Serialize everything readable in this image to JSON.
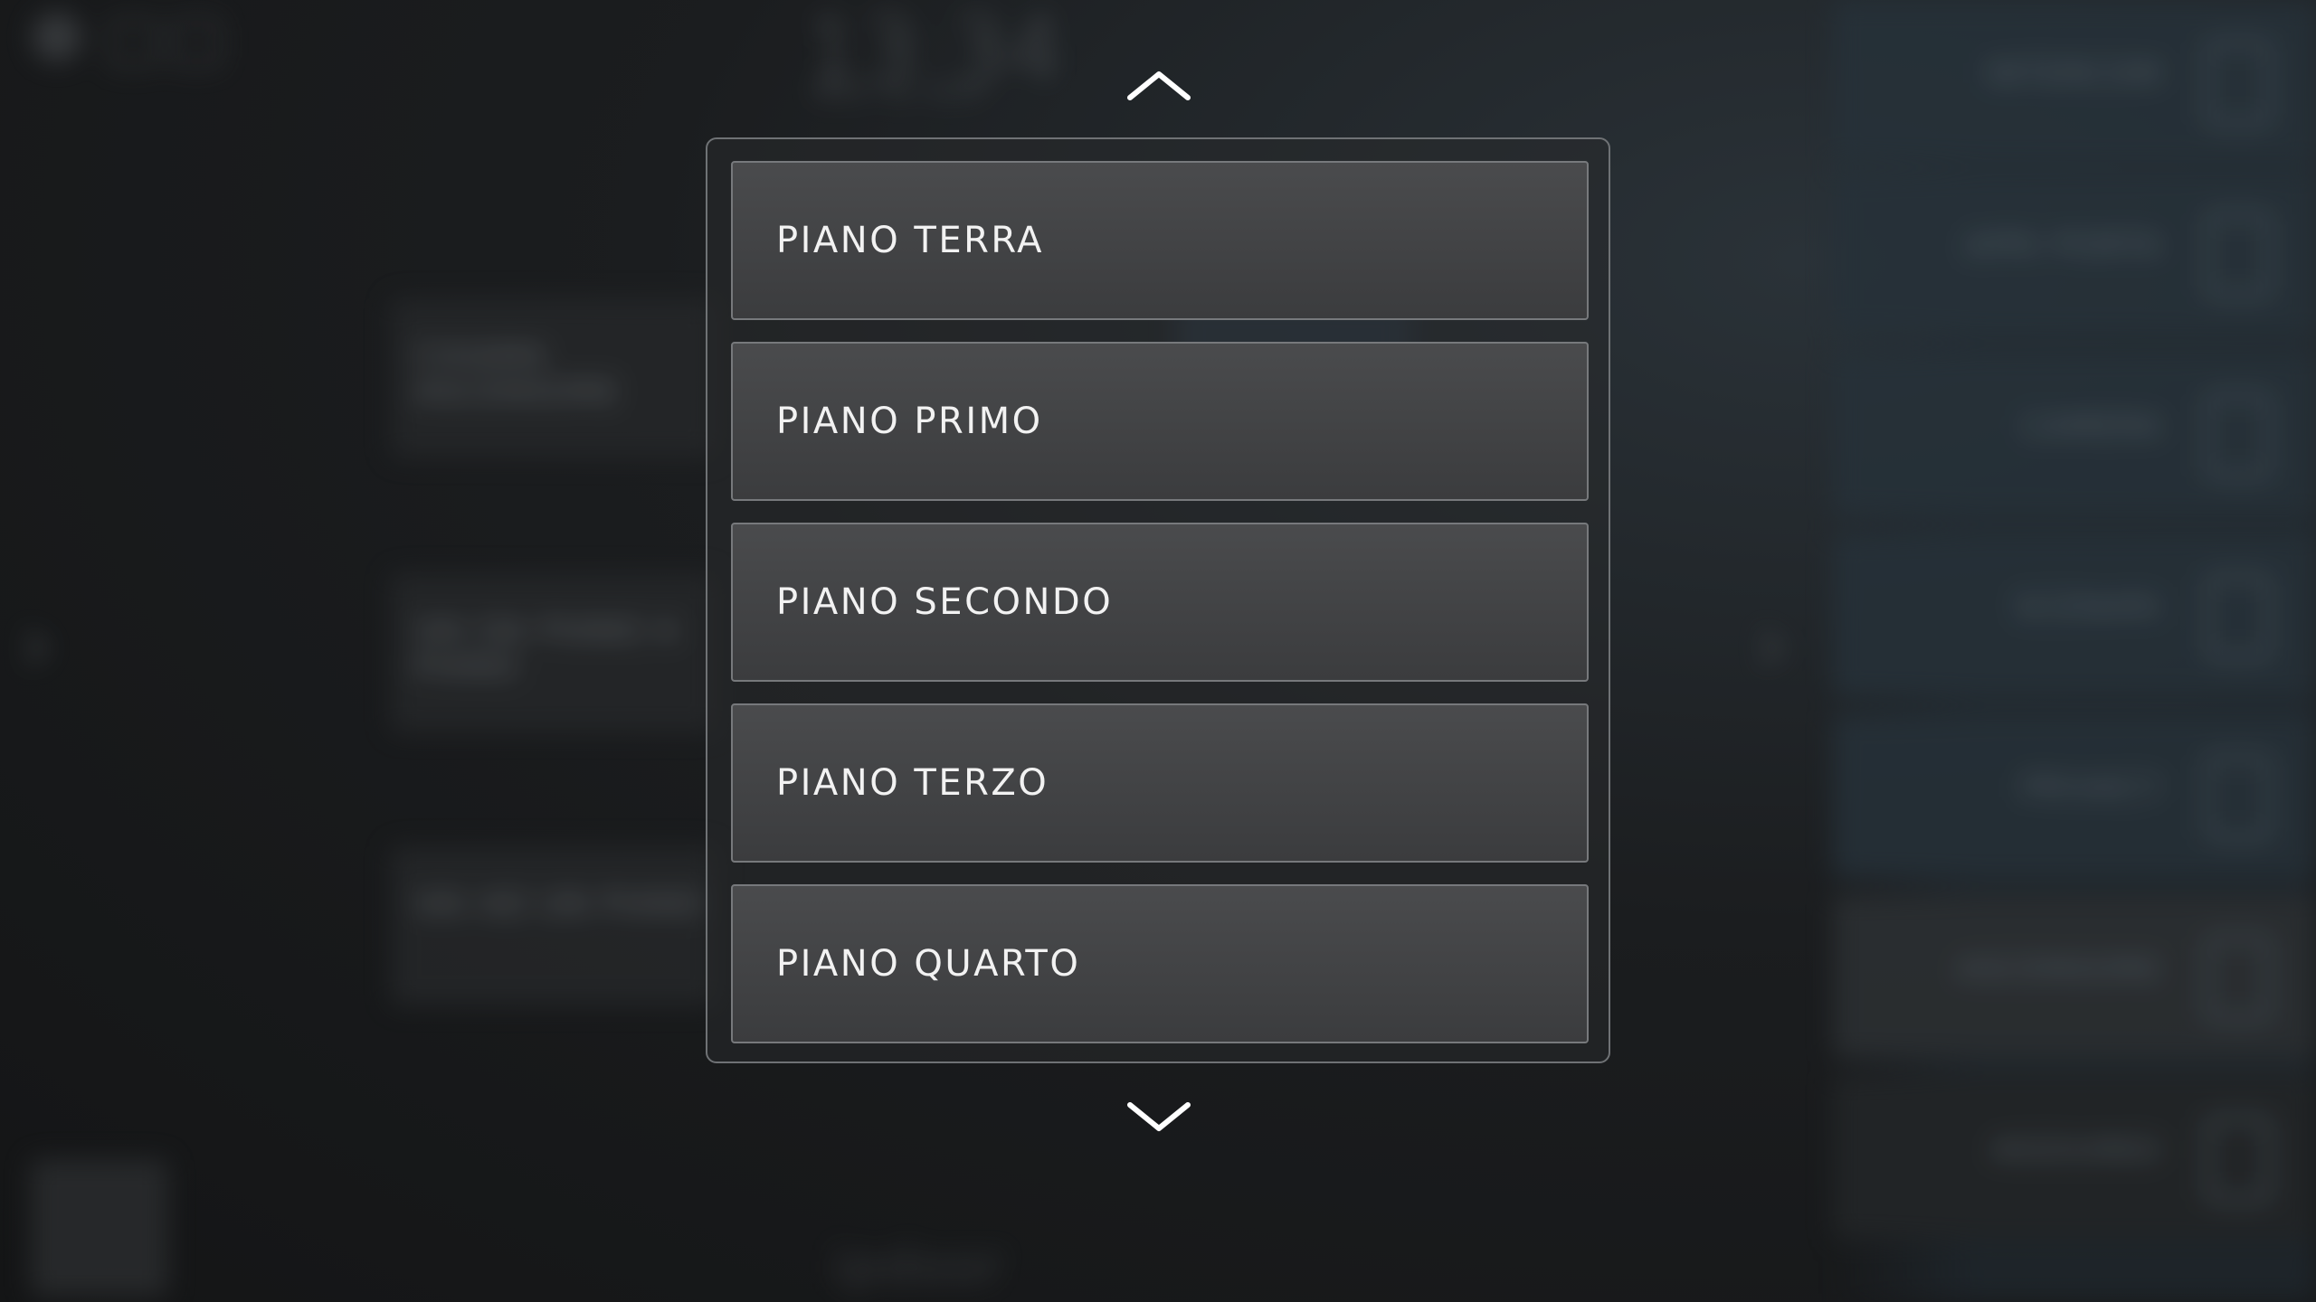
{
  "picker": {
    "up_icon": "chevron-up-icon",
    "down_icon": "chevron-down-icon",
    "floors": [
      {
        "label": "PIANO TERRA"
      },
      {
        "label": "PIANO PRIMO"
      },
      {
        "label": "PIANO SECONDO"
      },
      {
        "label": "PIANO TERZO"
      },
      {
        "label": "PIANO QUARTO"
      }
    ]
  },
  "background": {
    "clock": "13:34",
    "date": "MAR 30 NOV",
    "cards": [
      {
        "label": "CHIAMA ASCENSORE"
      },
      {
        "label": "VAI DA PIANO A PIANO"
      },
      {
        "label": "VAI AD UN PIANO"
      }
    ],
    "sidebar": [
      {
        "label": "INTERCOM",
        "icon": "phone-icon"
      },
      {
        "label": "APRI PORTA",
        "icon": "lock-icon"
      },
      {
        "label": "CAMERA",
        "icon": "camera-icon"
      },
      {
        "label": "SCENARI",
        "icon": "grid-icon"
      },
      {
        "label": "PRIVACY",
        "icon": "toggle-icon"
      },
      {
        "label": "ASCENSORE",
        "icon": "elevator-icon"
      },
      {
        "label": "AGGIUNGI",
        "icon": "plus-icon"
      }
    ],
    "logo": "ipdoor"
  },
  "colors": {
    "accent_text": "#f2f2f2",
    "item_border": "#77797c",
    "item_fill": "#434446",
    "background": "#161718"
  }
}
